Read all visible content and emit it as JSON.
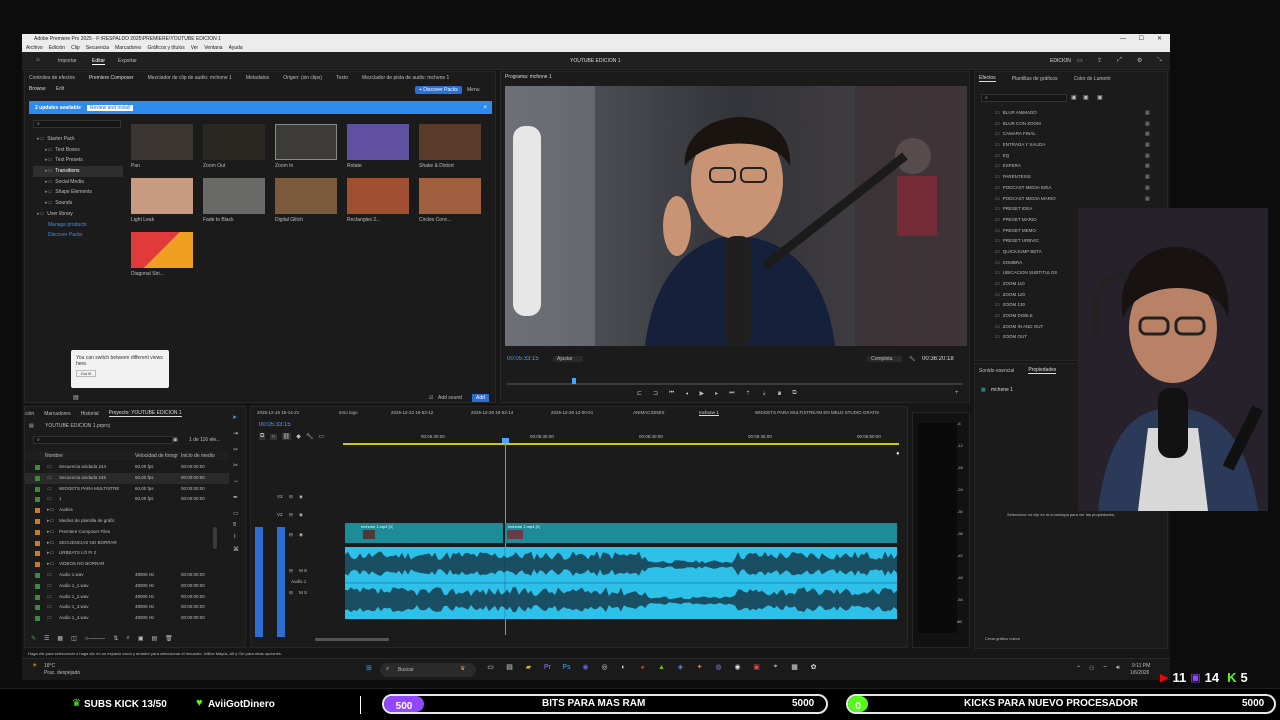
{
  "window": {
    "title": "Adobe Premiere Pro 2025 - F:\\RESPALDO 2025\\PREMIERE\\YOUTUBE EDICION 1",
    "menu": [
      "Archivo",
      "Edición",
      "Clip",
      "Secuencia",
      "Marcadores",
      "Gráficos y títulos",
      "Ver",
      "Ventana",
      "Ayuda"
    ],
    "workspace_tabs": [
      "Importar",
      "Editar",
      "Exportar"
    ],
    "project_title": "YOUTUBE EDICION 1",
    "edition_label": "EDICIÓN"
  },
  "source_panel": {
    "tabs": [
      "Controles de efectos",
      "Premiere Composer",
      "Mezclador de clip de audio: mchone 1",
      "Metadatos",
      "Origen: (sin clips)",
      "Texto",
      "Mezclador de pista de audio: mchone 1"
    ],
    "sub_tabs": [
      "Browse",
      "Edit"
    ],
    "discover_button": "+ Discover Packs",
    "menu_label": "Menu",
    "updates_text": "2 updates available",
    "review_button": "Review and Install",
    "tree": [
      "Starter Pack",
      "Text Boxes",
      "Text Presets",
      "Transitions",
      "Social Media",
      "Shape Elements",
      "Sounds",
      "User library",
      "Manage products",
      "Discover Packs"
    ],
    "thumbs": [
      "Pan",
      "Zoom Out",
      "Zoom In",
      "Rotate",
      "Shake & Distort",
      "Light Leak",
      "Fade to Black",
      "Digital Glitch",
      "Rectangles 2...",
      "Circles Conc...",
      "Diagonal Stri..."
    ],
    "tooltip_text": "You can switch between different views here.",
    "tooltip_button": "Got it!",
    "add_sound": "Add sound",
    "add_button": "Add"
  },
  "program_monitor": {
    "tab": "Programa: mchone 1",
    "timecode": "00:05:33:15",
    "fit": "Ajustar",
    "quality": "Completa",
    "duration": "00:36:20:18"
  },
  "effects_panel": {
    "tabs": [
      "Efectos",
      "Plantillas de gráficos",
      "Color de Lumetri"
    ],
    "items": [
      "BLUR ANIMADO",
      "BLUR CON ZOOM",
      "CAMARA FINAL",
      "ENTRADA Y SALIDA",
      "EQ",
      "ESFERA",
      "PARENTESIS",
      "PODCAST MEDIA IDEA",
      "PODCAST MEDIA MARIO",
      "PRESET IDEA",
      "PRESET MARIO",
      "PRESET MEMO",
      "PRESET URBVIC",
      "QUICKJUMP BETA",
      "SOMBRA",
      "UBICACION SUBTITULOS",
      "ZOOM 110",
      "ZOOM 120",
      "ZOOM 130",
      "ZOOM DOBLE",
      "ZOOM IN AND OUT",
      "ZOOM OUT"
    ]
  },
  "properties_panel": {
    "tabs": [
      "Sonido esencial",
      "Propiedades"
    ],
    "clip_name": "mchone 1",
    "hint": "Seleccione un clip en la cronología para ver las propiedades.",
    "create_graphic": "Crear gráfico nuevo"
  },
  "project_panel": {
    "tabs": [
      "ción",
      "Marcadores",
      "Historial",
      "Proyecto: YOUTUBE EDICION 1"
    ],
    "file": "YOUTUBE EDICION 1.prproj",
    "count": "1 de 116 ele...",
    "columns": [
      "Nombre",
      "Velocidad de fotogr",
      "Inicio de medio"
    ],
    "rows": [
      {
        "name": "Secuencia anidada 244",
        "rate": "60,00 fps",
        "start": "00:00:00:00",
        "color": "#3b8a3b"
      },
      {
        "name": "Secuencia anidada 245",
        "rate": "60,00 fps",
        "start": "00:00:00:00",
        "color": "#3b8a3b"
      },
      {
        "name": "WIDGETS PARA MULTISTRE",
        "rate": "60,00 fps",
        "start": "00:00:00:00",
        "color": "#3b8a3b"
      },
      {
        "name": "1",
        "rate": "60,00 fps",
        "start": "00:00:00:00",
        "color": "#3b8a3b"
      },
      {
        "name": "Audios",
        "rate": "",
        "start": "",
        "color": "#c97a2b"
      },
      {
        "name": "Medios de plantilla de gráfic",
        "rate": "",
        "start": "",
        "color": "#c97a2b"
      },
      {
        "name": "Premiere Composer Files",
        "rate": "",
        "start": "",
        "color": "#c97a2b"
      },
      {
        "name": "SECUENCIAS NO BORRAR",
        "rate": "",
        "start": "",
        "color": "#c97a2b"
      },
      {
        "name": "URBEATS LO FI 2",
        "rate": "",
        "start": "",
        "color": "#c97a2b"
      },
      {
        "name": "VIDEOS NO BORRAR",
        "rate": "",
        "start": "",
        "color": "#c97a2b"
      },
      {
        "name": "Audio 1.wav",
        "rate": "48000 Hz",
        "start": "00:00:00:00",
        "color": "#3b8a3b"
      },
      {
        "name": "Audio 1_1.wav",
        "rate": "48000 Hz",
        "start": "00:00:00:00",
        "color": "#3b8a3b"
      },
      {
        "name": "Audio 1_2.wav",
        "rate": "48000 Hz",
        "start": "00:00:00:00",
        "color": "#3b8a3b"
      },
      {
        "name": "Audio 1_3.wav",
        "rate": "48000 Hz",
        "start": "00:00:00:00",
        "color": "#3b8a3b"
      },
      {
        "name": "Audio 1_4.wav",
        "rate": "48000 Hz",
        "start": "00:00:00:00",
        "color": "#3b8a3b"
      }
    ]
  },
  "timeline": {
    "tabs": [
      "2025-12-15 15-14-21",
      "intro logo",
      "2025-12-22 16-53-12",
      "2025-12-28 18-52-14",
      "2025-12-26 13-00-51",
      "ANIMACIONES",
      "mchone 1",
      "WIDGETS PARA MULTISTREAM EN MELD STUDIO GRATIS"
    ],
    "timecode": "00:05:33:15",
    "ruler": [
      "00:05:30:00",
      "00:05:35:00",
      "00:05:40:00",
      "00:05:45:00",
      "00:05:50:00"
    ],
    "tracks": [
      "V3",
      "V2",
      "V1",
      "A1",
      "A2"
    ],
    "audio_label": "Audio 1",
    "clip1": "mchone 1.mp4 [V]",
    "clip2": "mchone 1.mp4 [V]",
    "meter_marks": [
      "-6",
      "-12",
      "-18",
      "-24",
      "-30",
      "-36",
      "-42",
      "-48",
      "-54",
      "dB"
    ]
  },
  "status_bar": {
    "text": "Haga clic para seleccionar o haga clic en un espacio vacío y arrastre para seleccionar el recuadro. Utilice Mayús, Alt y Ctrl para otras opciones."
  },
  "taskbar": {
    "weather_temp": "18°C",
    "weather_desc": "Prac. despejado",
    "search": "Buscar",
    "time": "9:11 PM",
    "date": "1/6/2026"
  },
  "stream": {
    "youtube_count": "11",
    "twitch_count": "14",
    "kick_count": "5",
    "subs": "SUBS KICK 13/50",
    "donor": "AviiGotDinero",
    "goal1_badge": "500",
    "goal1_label": "BITS PARA MAS RAM",
    "goal1_target": "5000",
    "goal2_badge": "0",
    "goal2_label": "KICKS PARA NUEVO PROCESADOR",
    "goal2_target": "5000",
    "colors": {
      "youtube": "#ff0000",
      "twitch": "#9146ff",
      "kick": "#53fc18",
      "accent": "#2d8ceb"
    }
  }
}
